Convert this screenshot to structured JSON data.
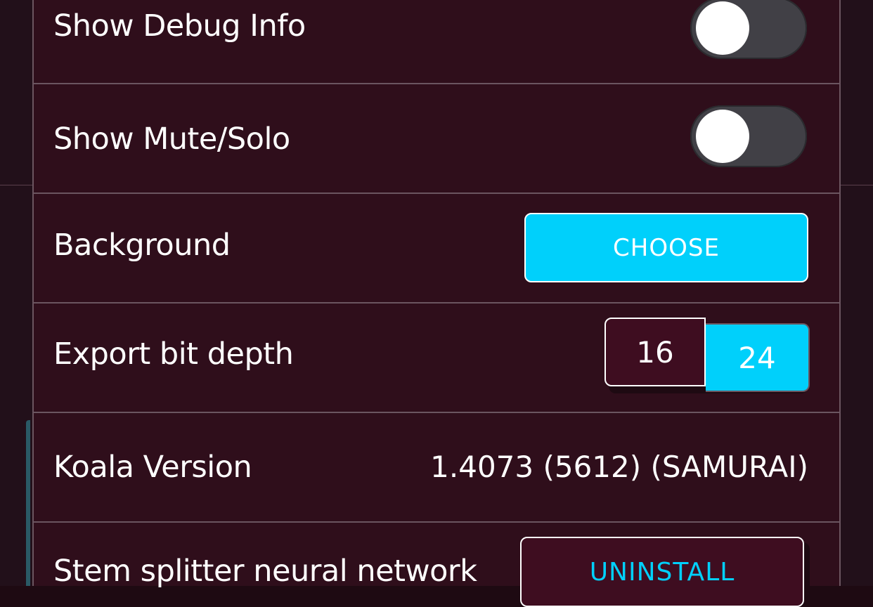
{
  "settings": {
    "debug_info": {
      "label": "Show Debug Info",
      "enabled": false
    },
    "mute_solo": {
      "label": "Show Mute/Solo",
      "enabled": false
    },
    "background": {
      "label": "Background",
      "button": "CHOOSE"
    },
    "export_bit_depth": {
      "label": "Export bit depth",
      "options": [
        "16",
        "24"
      ],
      "selected": "24"
    },
    "koala_version": {
      "label": "Koala Version",
      "value": "1.4073 (5612) (SAMURAI)"
    },
    "stem_splitter": {
      "label": "Stem splitter neural network",
      "button": "UNINSTALL"
    }
  },
  "colors": {
    "panel_bg": "#2f0e1b",
    "accent": "#00d0fb",
    "toggle_off": "#414046",
    "divider": "#6b5560"
  }
}
